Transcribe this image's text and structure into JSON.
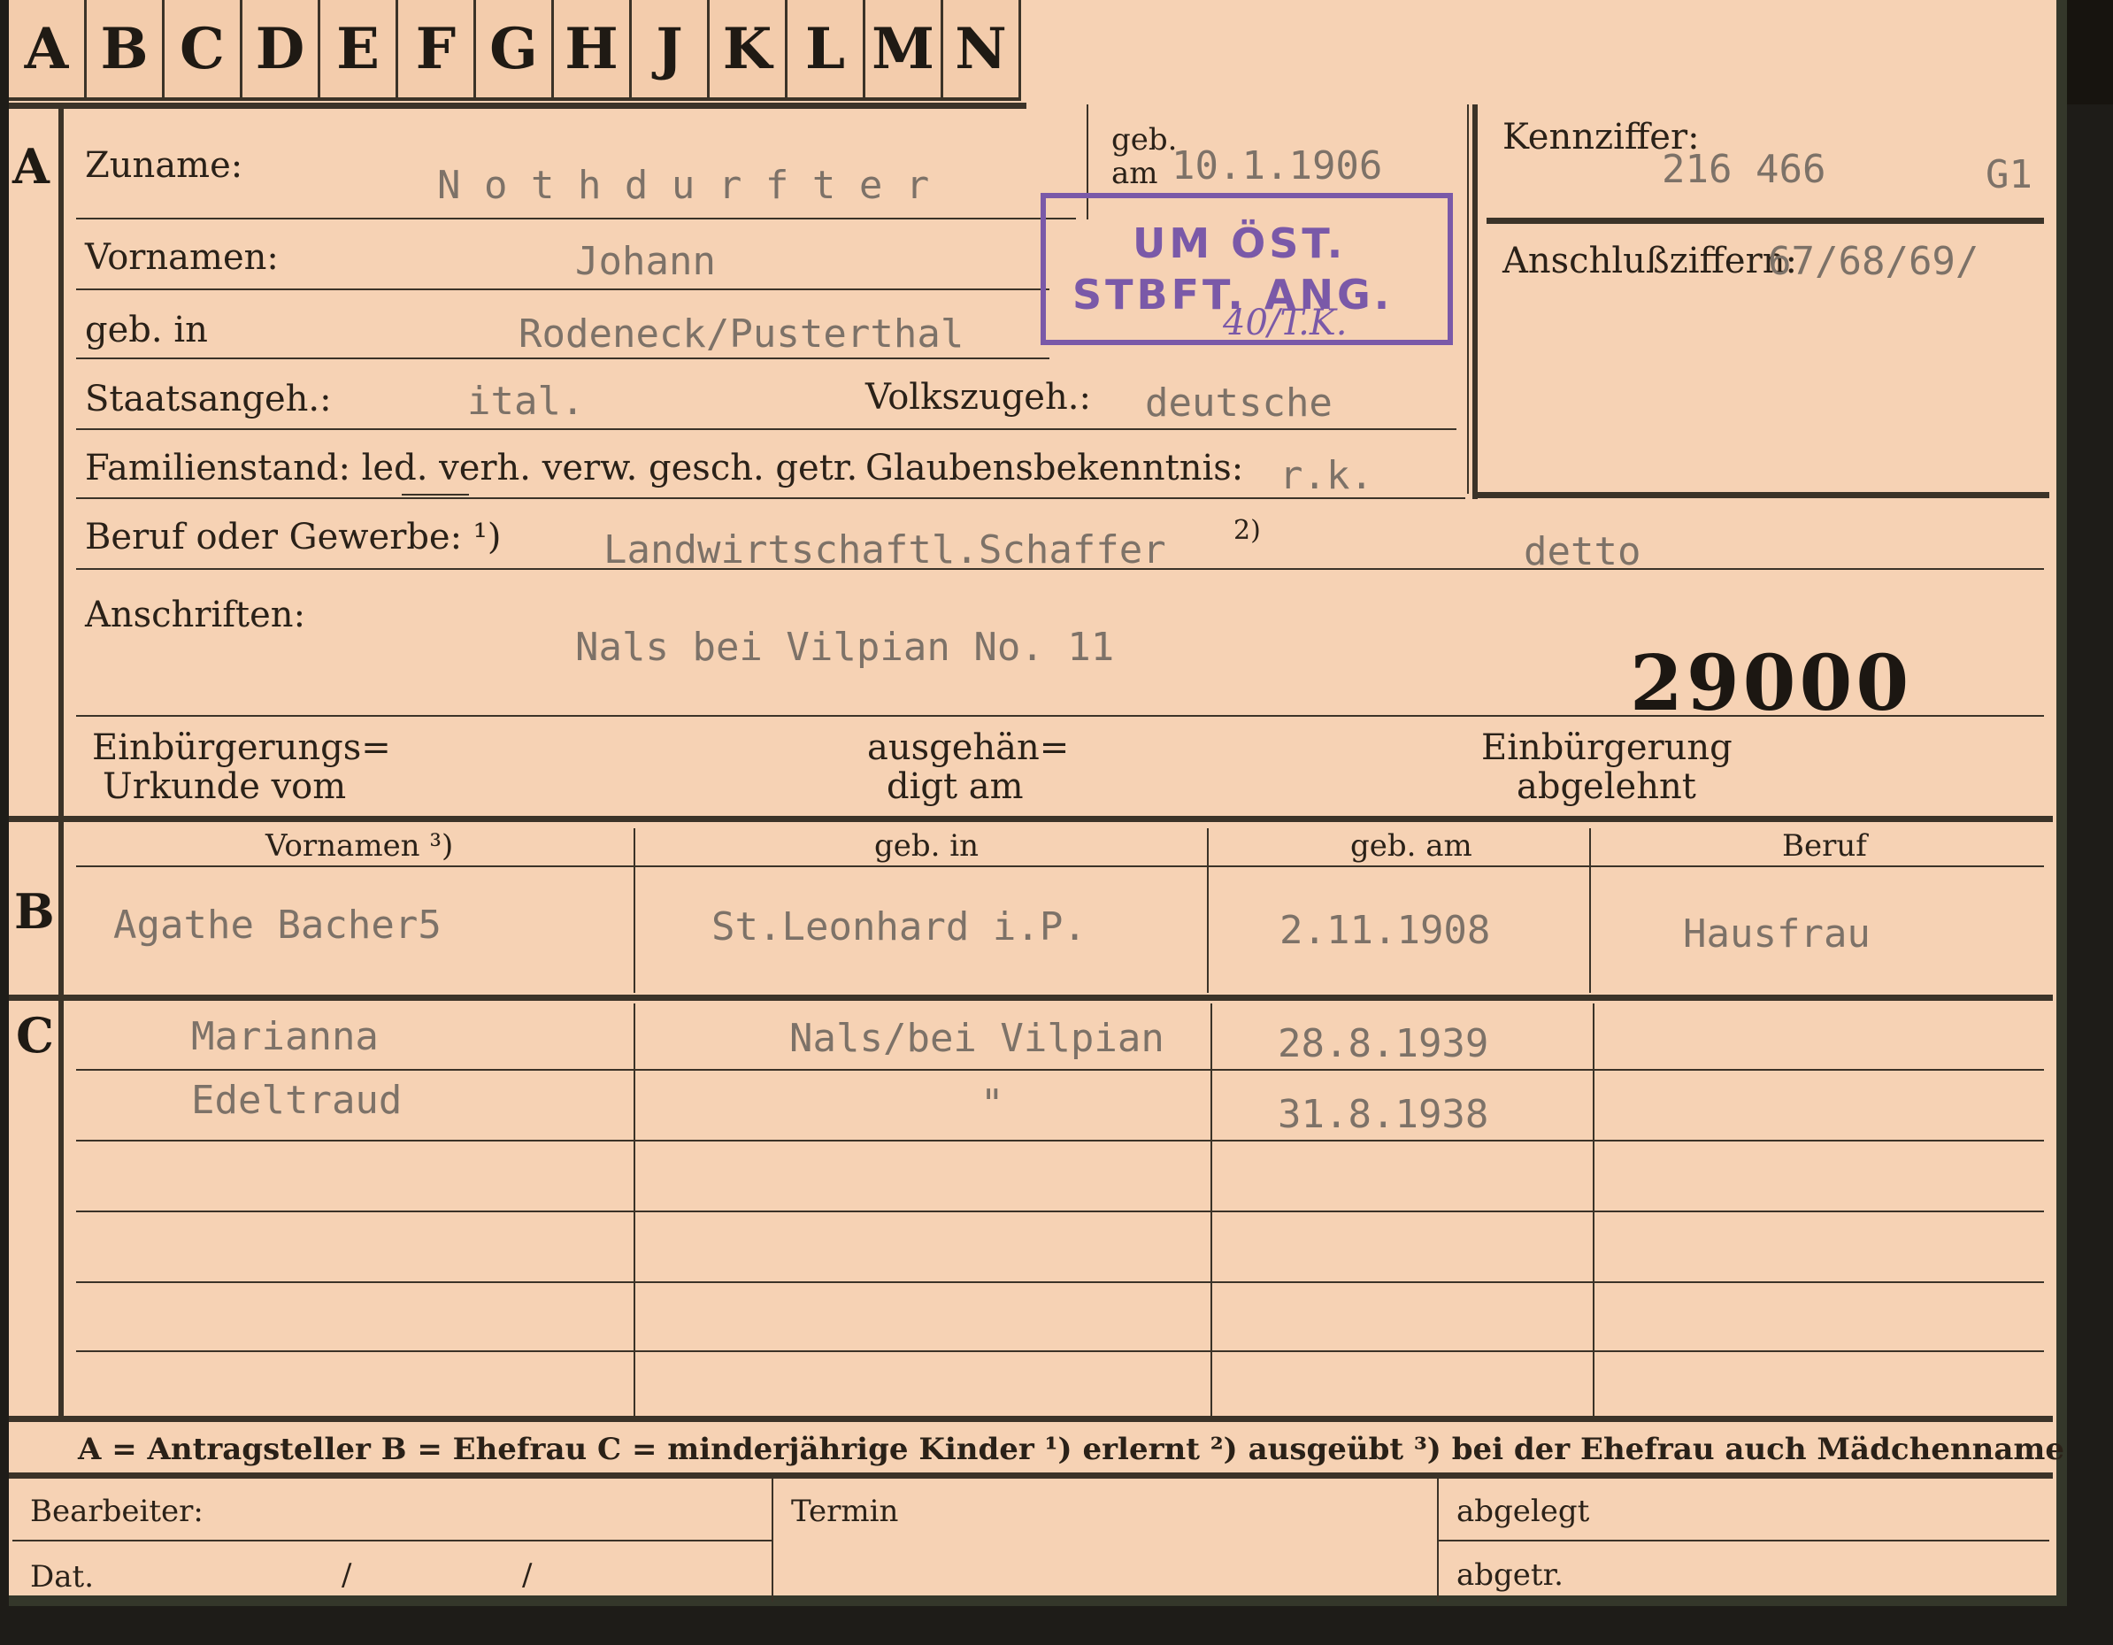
{
  "tabs": [
    "A",
    "B",
    "C",
    "D",
    "E",
    "F",
    "G",
    "H",
    "J",
    "K",
    "L",
    "M",
    "N"
  ],
  "sections": {
    "a": "A",
    "b": "B",
    "c": "C"
  },
  "labels": {
    "zuname": "Zuname:",
    "geb_am_top": "geb.",
    "geb_am_bottom": "am",
    "kennziffer": "Kennziffer:",
    "vornamen": "Vornamen:",
    "anschlussziffern": "Anschlußziffern:",
    "geb_in": "geb. in",
    "staatsangeh": "Staatsangeh.:",
    "volkszugeh": "Volkszugeh.:",
    "familienstand": "Familienstand: led. verh. verw. gesch. getr.",
    "glaubens": "Glaubensbekenntnis:",
    "beruf": "Beruf oder Gewerbe: ¹)",
    "anschriften": "Anschriften:",
    "einb_urkunde_1": "Einbürgerungs=",
    "einb_urkunde_2": "Urkunde vom",
    "ausgehaen_1": "ausgehän=",
    "ausgehaen_2": "digt am",
    "einb_abgelehnt_1": "Einbürgerung",
    "einb_abgelehnt_2": "abgelehnt"
  },
  "applicant": {
    "zuname": "N o t h d u r f t e r",
    "geb_am": "10.1.1906",
    "kennziffer": "216 466",
    "kennziffer_suffix": "G1",
    "vornamen": "Johann",
    "anschlussziffern": "67/68/69/",
    "geb_in": "Rodeneck/Pusterthal",
    "staatsangeh": "ital.",
    "volkszugeh": "deutsche",
    "glaube": "r.k.",
    "beruf": "Landwirtschaftl.Schaffer",
    "beruf_note": "2)",
    "beruf_ausgeuebt": "detto",
    "anschrift": "Nals bei Vilpian No. 11",
    "big_number": "29000"
  },
  "stamp": {
    "line1": "UM ÖST.",
    "line2": "STBFT. ANG.",
    "handwritten": "40/T.K."
  },
  "wife_table": {
    "headers": [
      "Vornamen ³)",
      "geb. in",
      "geb. am",
      "Beruf"
    ],
    "row": [
      "Agathe Bacher5",
      "St.Leonhard i.P.",
      "2.11.1908",
      "Hausfrau"
    ]
  },
  "children": [
    {
      "name": "Marianna",
      "place": "Nals/bei Vilpian",
      "date": "28.8.1939"
    },
    {
      "name": "Edeltraud",
      "place": "\"",
      "date": "31.8.1938"
    }
  ],
  "legend": "A = Antragsteller   B = Ehefrau   C = minderjährige Kinder   ¹) erlernt   ²) ausgeübt   ³) bei der Ehefrau auch Mädchenname",
  "bottom": {
    "bearbeiter": "Bearbeiter:",
    "dat": "Dat.",
    "slash1": "/",
    "slash2": "/",
    "termin": "Termin",
    "abgelegt": "abgelegt",
    "abgetr": "abgetr."
  },
  "colors": {
    "card": "#f6d2b4",
    "ink": "#2a2118",
    "type": "#7d7268",
    "stamp": "#7a59a8"
  }
}
